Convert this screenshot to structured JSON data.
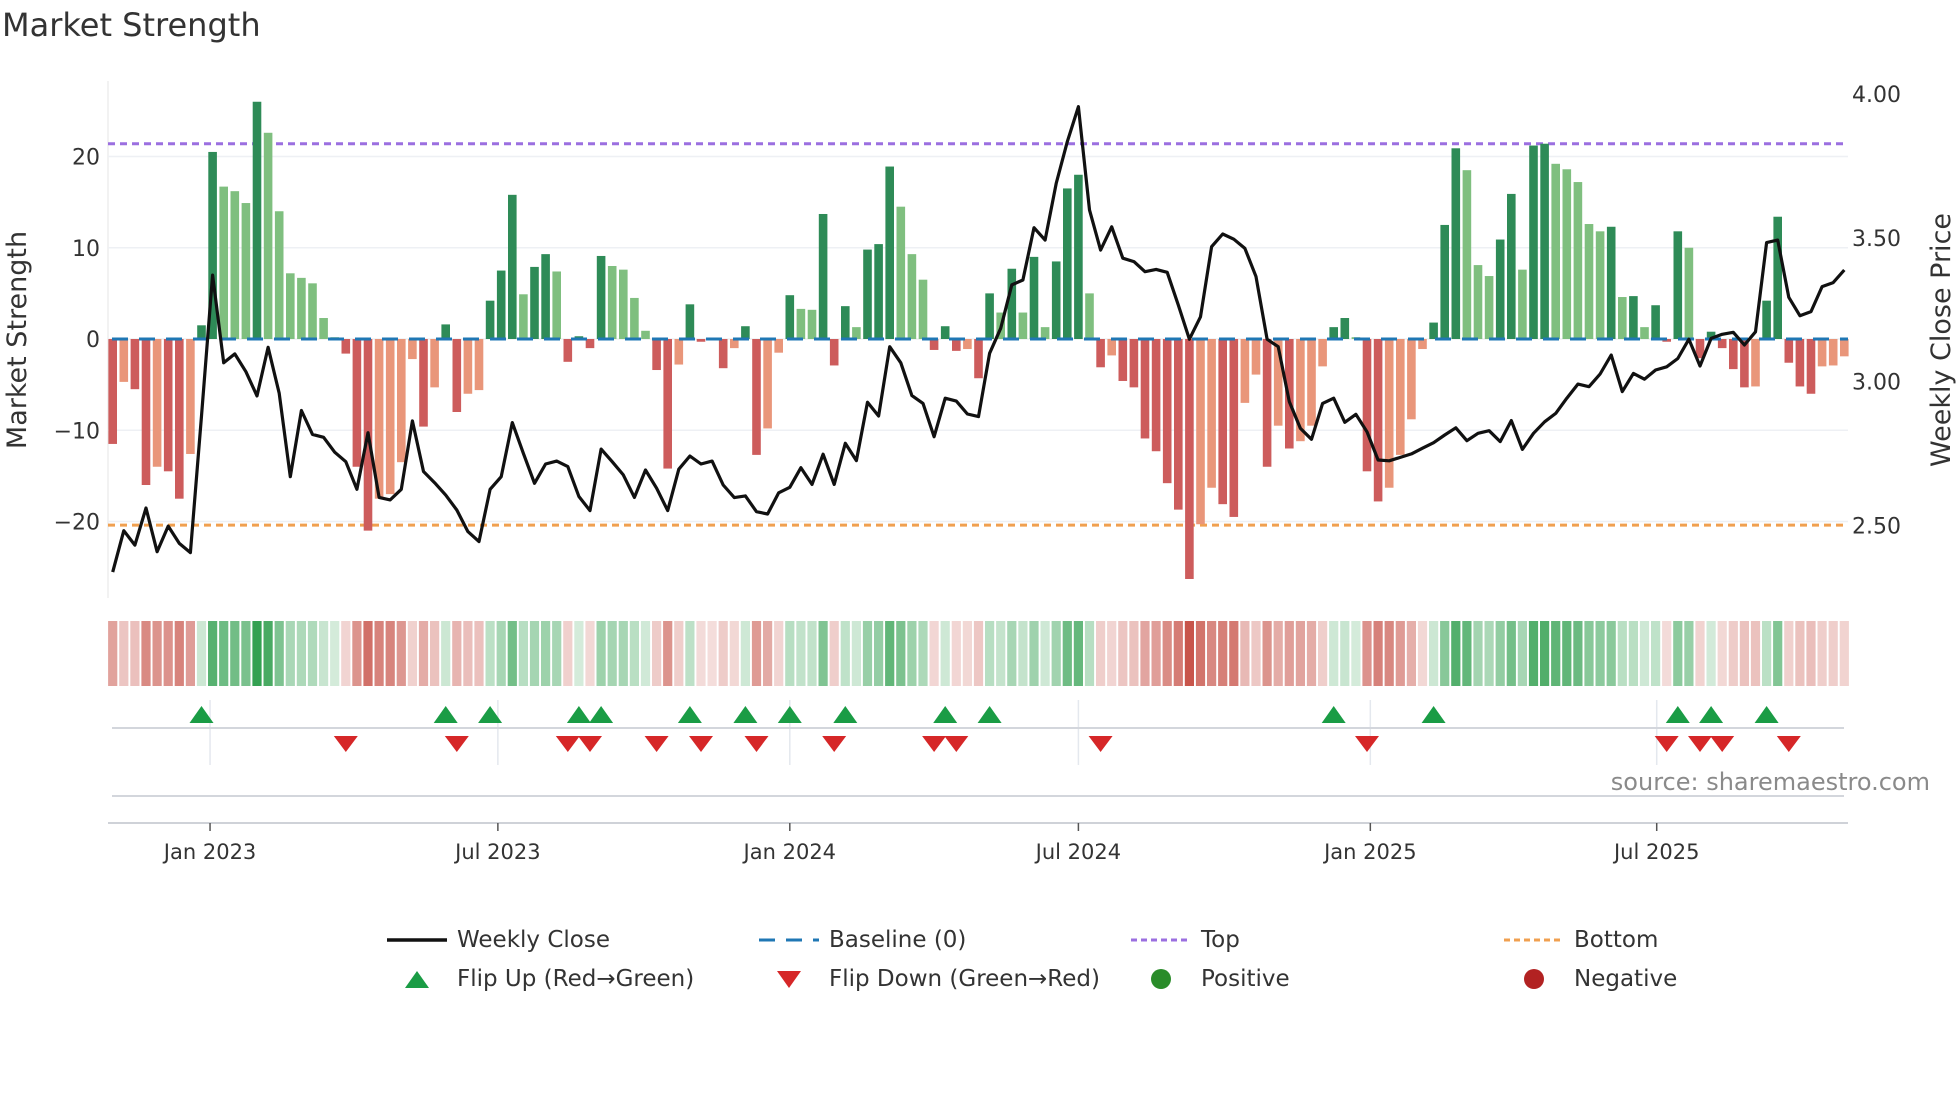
{
  "title": "Market Strength",
  "source": "source: sharemaestro.com",
  "colors": {
    "pos_dark": "#2e8b57",
    "pos_light": "#7fbf7f",
    "neg_dark": "#cd5c5c",
    "neg_light": "#e9967a",
    "line": "#111111",
    "baseline": "#1f77b4",
    "top": "#9b6fe0",
    "bottom": "#f0a050",
    "flip_up": "#1a9c45",
    "flip_down": "#d62728",
    "positive": "#2a8c2a",
    "negative": "#b22222"
  },
  "legend": [
    {
      "label": "Weekly Close",
      "kind": "line"
    },
    {
      "label": "Baseline (0)",
      "kind": "dash"
    },
    {
      "label": "Top",
      "kind": "dotpurple"
    },
    {
      "label": "Bottom",
      "kind": "dotorange"
    },
    {
      "label": "Flip Up (Red→Green)",
      "kind": "up"
    },
    {
      "label": "Flip Down (Green→Red)",
      "kind": "down"
    },
    {
      "label": "Positive",
      "kind": "pos"
    },
    {
      "label": "Negative",
      "kind": "neg"
    }
  ],
  "chart_data": {
    "type": "bar",
    "title": "Market Strength",
    "ylabel": "Market Strength",
    "y2label": "Weekly Close Price",
    "ylim": [
      -27.5,
      29
    ],
    "y2lim": [
      2.32,
      4.05
    ],
    "yticks": [
      -20,
      -10,
      0,
      10,
      20
    ],
    "yticklabels": [
      "−20",
      "−10",
      "0",
      "10",
      "20"
    ],
    "y2ticks": [
      2.5,
      3.0,
      3.5,
      4.0
    ],
    "y2ticklabels": [
      "2.50",
      "3.00",
      "3.50",
      "4.00"
    ],
    "top_level": 21.4,
    "bottom_level": -20.4,
    "baseline": 0,
    "x_unit": "week index (1 = first week shown)",
    "xticks": [
      {
        "week": 9.77,
        "label": "Jan 2023"
      },
      {
        "week": 35.7,
        "label": "Jul 2023"
      },
      {
        "week": 62.0,
        "label": "Jan 2024"
      },
      {
        "week": 88.0,
        "label": "Jul 2024"
      },
      {
        "week": 114.3,
        "label": "Jan 2025"
      },
      {
        "week": 140.1,
        "label": "Jul 2025"
      }
    ],
    "strength": [
      -11.5,
      -4.7,
      -5.5,
      -16,
      -14,
      -14.5,
      -17.5,
      -12.6,
      1.5,
      20.5,
      16.7,
      16.2,
      14.9,
      26,
      22.6,
      14,
      7.2,
      6.7,
      6.1,
      2.3,
      0.2,
      -1.6,
      -14,
      -21,
      -17.5,
      -17,
      -13.5,
      -2.2,
      -9.6,
      -5.3,
      1.6,
      -8,
      -6,
      -5.6,
      4.2,
      7.5,
      15.8,
      4.9,
      7.9,
      9.3,
      7.4,
      -2.5,
      0.3,
      -1,
      9.1,
      8,
      7.6,
      4.5,
      0.9,
      -3.4,
      -14.2,
      -2.8,
      3.8,
      -0.3,
      -0.1,
      -3.2,
      -1,
      1.4,
      -12.7,
      -9.8,
      -1.5,
      4.8,
      3.3,
      3.2,
      13.7,
      -2.9,
      3.6,
      1.3,
      9.8,
      10.4,
      18.9,
      14.5,
      9.3,
      6.5,
      -1.2,
      1.4,
      -1.3,
      -1.1,
      -4.3,
      5,
      2.9,
      7.7,
      2.9,
      9,
      1.3,
      8.5,
      16.5,
      18,
      5,
      -3.1,
      -1.8,
      -4.6,
      -5.3,
      -10.9,
      -12.3,
      -15.8,
      -18.7,
      -26.3,
      -20.3,
      -16.3,
      -18.1,
      -19.5,
      -7,
      -3.9,
      -14,
      -9.5,
      -12,
      -11.2,
      -9.5,
      -3,
      1.3,
      2.3,
      0.2,
      -14.5,
      -17.8,
      -16.3,
      -12.7,
      -8.8,
      -1.1,
      1.8,
      12.5,
      20.9,
      18.5,
      8.1,
      6.9,
      10.9,
      15.9,
      7.6,
      21.2,
      21.4,
      19.2,
      18.6,
      17.2,
      12.6,
      11.8,
      12.3,
      4.6,
      4.7,
      1.3,
      3.7,
      -0.3,
      11.8,
      10,
      -2.1,
      0.8,
      -1,
      -3.3,
      -5.3,
      -5.2,
      4.2,
      13.4,
      -2.6,
      -5.2,
      -6,
      -3,
      -2.9,
      -1.9
    ],
    "weekly_close": [
      2.337,
      2.481,
      2.431,
      2.56,
      2.408,
      2.497,
      2.437,
      2.405,
      2.88,
      3.37,
      3.065,
      3.096,
      3.034,
      2.95,
      3.119,
      2.959,
      2.669,
      2.899,
      2.816,
      2.806,
      2.754,
      2.721,
      2.625,
      2.822,
      2.597,
      2.588,
      2.625,
      2.863,
      2.687,
      2.648,
      2.605,
      2.553,
      2.478,
      2.443,
      2.625,
      2.669,
      2.857,
      2.75,
      2.646,
      2.713,
      2.723,
      2.704,
      2.6,
      2.551,
      2.765,
      2.721,
      2.675,
      2.597,
      2.692,
      2.629,
      2.551,
      2.695,
      2.741,
      2.713,
      2.723,
      2.64,
      2.596,
      2.602,
      2.547,
      2.539,
      2.613,
      2.632,
      2.7,
      2.642,
      2.747,
      2.642,
      2.785,
      2.725,
      2.928,
      2.88,
      3.121,
      3.065,
      2.951,
      2.924,
      2.808,
      2.942,
      2.932,
      2.887,
      2.878,
      3.098,
      3.185,
      3.336,
      3.353,
      3.535,
      3.492,
      3.689,
      3.834,
      3.956,
      3.597,
      3.457,
      3.538,
      3.429,
      3.417,
      3.382,
      3.39,
      3.38,
      3.266,
      3.147,
      3.225,
      3.469,
      3.513,
      3.495,
      3.463,
      3.365,
      3.147,
      3.121,
      2.93,
      2.837,
      2.799,
      2.924,
      2.942,
      2.858,
      2.886,
      2.825,
      2.727,
      2.724,
      2.736,
      2.748,
      2.768,
      2.787,
      2.814,
      2.839,
      2.794,
      2.82,
      2.829,
      2.791,
      2.864,
      2.764,
      2.82,
      2.86,
      2.889,
      2.942,
      2.991,
      2.982,
      3.026,
      3.092,
      2.965,
      3.028,
      3.008,
      3.04,
      3.051,
      3.08,
      3.147,
      3.054,
      3.15,
      3.164,
      3.171,
      3.127,
      3.173,
      3.483,
      3.492,
      3.293,
      3.229,
      3.243,
      3.33,
      3.344,
      3.388
    ],
    "flip_up_weeks": [
      9,
      31,
      35,
      43,
      45,
      53,
      58,
      62,
      67,
      76,
      80,
      111,
      120,
      142,
      145,
      150
    ],
    "flip_down_weeks": [
      22,
      32,
      42,
      44,
      50,
      54,
      59,
      66,
      75,
      77,
      90,
      114,
      141,
      144,
      146,
      152
    ]
  }
}
